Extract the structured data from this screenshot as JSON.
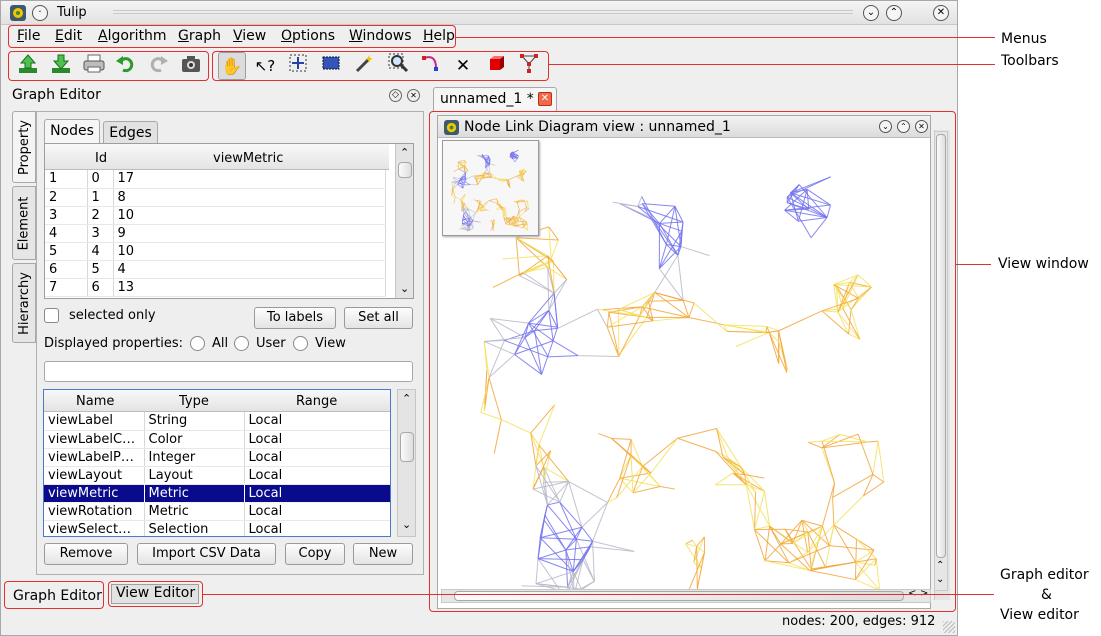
{
  "window": {
    "title": "Tulip"
  },
  "menu": [
    {
      "label": "File",
      "u": "F",
      "rest": "ile"
    },
    {
      "label": "Edit",
      "u": "E",
      "rest": "dit"
    },
    {
      "label": "Algorithm",
      "u": "A",
      "rest": "lgorithm"
    },
    {
      "label": "Graph",
      "u": "G",
      "rest": "raph"
    },
    {
      "label": "View",
      "u": "V",
      "rest": "iew"
    },
    {
      "label": "Options",
      "u": "O",
      "rest": "ptions"
    },
    {
      "label": "Windows",
      "u": "W",
      "rest": "indows"
    },
    {
      "label": "Help",
      "u": "H",
      "rest": "elp"
    }
  ],
  "toolbar1": [
    "import-icon",
    "export-icon",
    "print-icon",
    "undo-icon",
    "redo-icon",
    "camera-icon"
  ],
  "toolbar2": [
    "hand-icon",
    "pointer-help-icon",
    "zoom-box-icon",
    "select-rect-icon",
    "magic-wand-icon",
    "magnifier-icon",
    "bend-edge-icon",
    "delete-icon",
    "cube-icon",
    "graph-edit-icon"
  ],
  "graph_editor": {
    "title": "Graph Editor",
    "side_tabs": [
      "Property",
      "Element",
      "Hierarchy"
    ],
    "tabs": [
      "Nodes",
      "Edges"
    ],
    "node_table": {
      "headers": [
        "Id",
        "viewMetric"
      ],
      "rows": [
        {
          "n": "1",
          "id": "0",
          "v": "17"
        },
        {
          "n": "2",
          "id": "1",
          "v": "8"
        },
        {
          "n": "3",
          "id": "2",
          "v": "10"
        },
        {
          "n": "4",
          "id": "3",
          "v": "9"
        },
        {
          "n": "5",
          "id": "4",
          "v": "10"
        },
        {
          "n": "6",
          "id": "5",
          "v": "4"
        },
        {
          "n": "7",
          "id": "6",
          "v": "13"
        }
      ]
    },
    "selected_only": "selected only",
    "to_labels": "To labels",
    "set_all": "Set all",
    "displayed_properties": "Displayed properties:",
    "radios": [
      "All",
      "User",
      "View"
    ],
    "filter_value": "",
    "prop_table": {
      "headers": [
        "Name",
        "Type",
        "Range"
      ],
      "rows": [
        {
          "name": "viewLabel",
          "type": "String",
          "range": "Local"
        },
        {
          "name": "viewLabelC…",
          "type": "Color",
          "range": "Local"
        },
        {
          "name": "viewLabelP…",
          "type": "Integer",
          "range": "Local"
        },
        {
          "name": "viewLayout",
          "type": "Layout",
          "range": "Local"
        },
        {
          "name": "viewMetric",
          "type": "Metric",
          "range": "Local"
        },
        {
          "name": "viewRotation",
          "type": "Metric",
          "range": "Local"
        },
        {
          "name": "viewSelect…",
          "type": "Selection",
          "range": "Local"
        }
      ],
      "selected_index": 4
    },
    "buttons": [
      "Remove",
      "Import CSV Data",
      "Copy",
      "New"
    ]
  },
  "bottom_tabs": [
    "Graph Editor",
    "View Editor"
  ],
  "doc_tab": "unnamed_1 *",
  "view": {
    "title": "Node Link Diagram view : unnamed_1"
  },
  "status": "nodes: 200, edges: 912",
  "annotations": {
    "menus": "Menus",
    "toolbars": "Toolbars",
    "view_window": "View window",
    "editor_line1": "Graph editor",
    "editor_line2": "&",
    "editor_line3": "View editor"
  },
  "colors": {
    "accent_red": "#e03030",
    "selection": "#0a0a8c",
    "edge_orange": "#e88a1a",
    "edge_yellow": "#f5e04a",
    "edge_blue": "#6f6ff0"
  }
}
